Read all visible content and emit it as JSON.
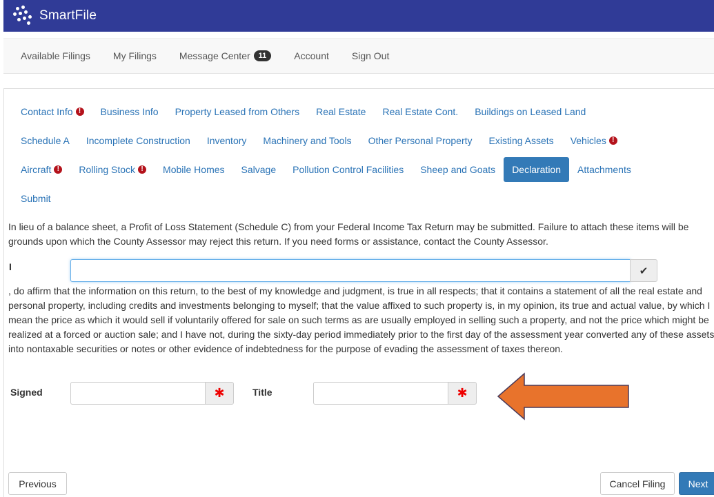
{
  "app": {
    "brand": "SmartFile",
    "accent_color": "#303b97"
  },
  "nav": {
    "items": [
      {
        "label": "Available Filings"
      },
      {
        "label": "My Filings"
      },
      {
        "label": "Message Center",
        "badge": "11"
      },
      {
        "label": "Account"
      },
      {
        "label": "Sign Out"
      }
    ]
  },
  "tabs": {
    "row1": [
      {
        "label": "Contact Info",
        "alert": true
      },
      {
        "label": "Business Info"
      },
      {
        "label": "Property Leased from Others"
      },
      {
        "label": "Real Estate"
      },
      {
        "label": "Real Estate Cont."
      },
      {
        "label": "Buildings on Leased Land"
      }
    ],
    "row2": [
      {
        "label": "Schedule A"
      },
      {
        "label": "Incomplete Construction"
      },
      {
        "label": "Inventory"
      },
      {
        "label": "Machinery and Tools"
      },
      {
        "label": "Other Personal Property"
      },
      {
        "label": "Existing Assets"
      },
      {
        "label": "Vehicles",
        "alert": true
      }
    ],
    "row3": [
      {
        "label": "Aircraft",
        "alert": true
      },
      {
        "label": "Rolling Stock",
        "alert": true
      },
      {
        "label": "Mobile Homes"
      },
      {
        "label": "Salvage"
      },
      {
        "label": "Pollution Control Facilities"
      },
      {
        "label": "Sheep and Goats"
      },
      {
        "label": "Declaration",
        "active": true
      },
      {
        "label": "Attachments"
      }
    ],
    "row4": [
      {
        "label": "Submit"
      }
    ]
  },
  "declaration": {
    "intro": "In lieu of a balance sheet, a Profit of Loss Statement (Schedule C) from your Federal Income Tax Return may be submitted. Failure to attach these items will be grounds upon which the County Assessor may reject this return. If you need forms or assistance, contact the County Assessor.",
    "i_label": "I",
    "name_value": "",
    "affirm": ", do affirm that the information on this return, to the best of my knowledge and judgment, is true in all respects; that it contains a statement of all the real estate and personal property, including credits and investments belonging to myself; that the value affixed to such property is, in my opinion, its true and actual value, by which I mean the price as which it would sell if voluntarily offered for sale on such terms as are usually employed in selling such a property, and not the price which might be realized at a forced or auction sale; and I have not, during the sixty-day period immediately prior to the first day of the assessment year converted any of these assets into nontaxable securities or notes or other evidence of indebtedness for the purpose of evading the assessment of taxes thereon.",
    "signed_label": "Signed",
    "signed_value": "",
    "title_label": "Title",
    "title_value": "",
    "required_mark": "✱"
  },
  "footer": {
    "previous": "Previous",
    "cancel": "Cancel Filing",
    "next": "Next"
  },
  "annotation": {
    "arrow_color": "#e8732c"
  }
}
